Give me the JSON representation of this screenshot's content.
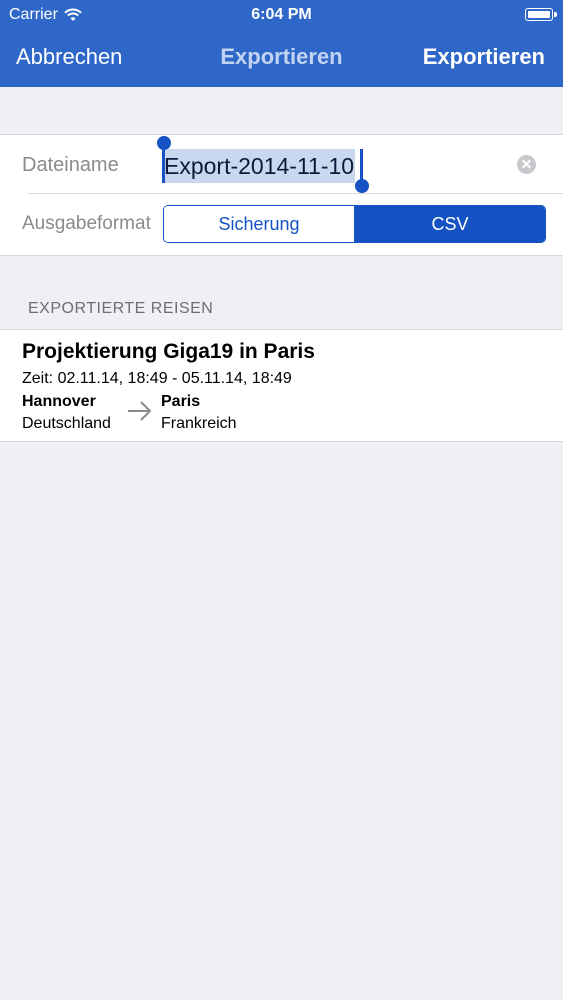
{
  "status_bar": {
    "carrier": "Carrier",
    "time": "6:04 PM"
  },
  "nav": {
    "cancel_label": "Abbrechen",
    "title": "Exportieren",
    "export_label": "Exportieren"
  },
  "form": {
    "filename_label": "Dateiname",
    "filename_value": "Export-2014-11-10",
    "format_label": "Ausgabeformat",
    "format_options": [
      "Sicherung",
      "CSV"
    ],
    "format_selected": "CSV"
  },
  "section": {
    "header": "EXPORTIERTE REISEN"
  },
  "trips": [
    {
      "title": "Projektierung Giga19 in Paris",
      "time": "Zeit: 02.11.14, 18:49 - 05.11.14, 18:49",
      "from_city": "Hannover",
      "from_country": "Deutschland",
      "to_city": "Paris",
      "to_country": "Frankreich"
    }
  ],
  "colors": {
    "nav_bg": "#2f67c9",
    "accent": "#1552c4",
    "background": "#efeff4"
  }
}
